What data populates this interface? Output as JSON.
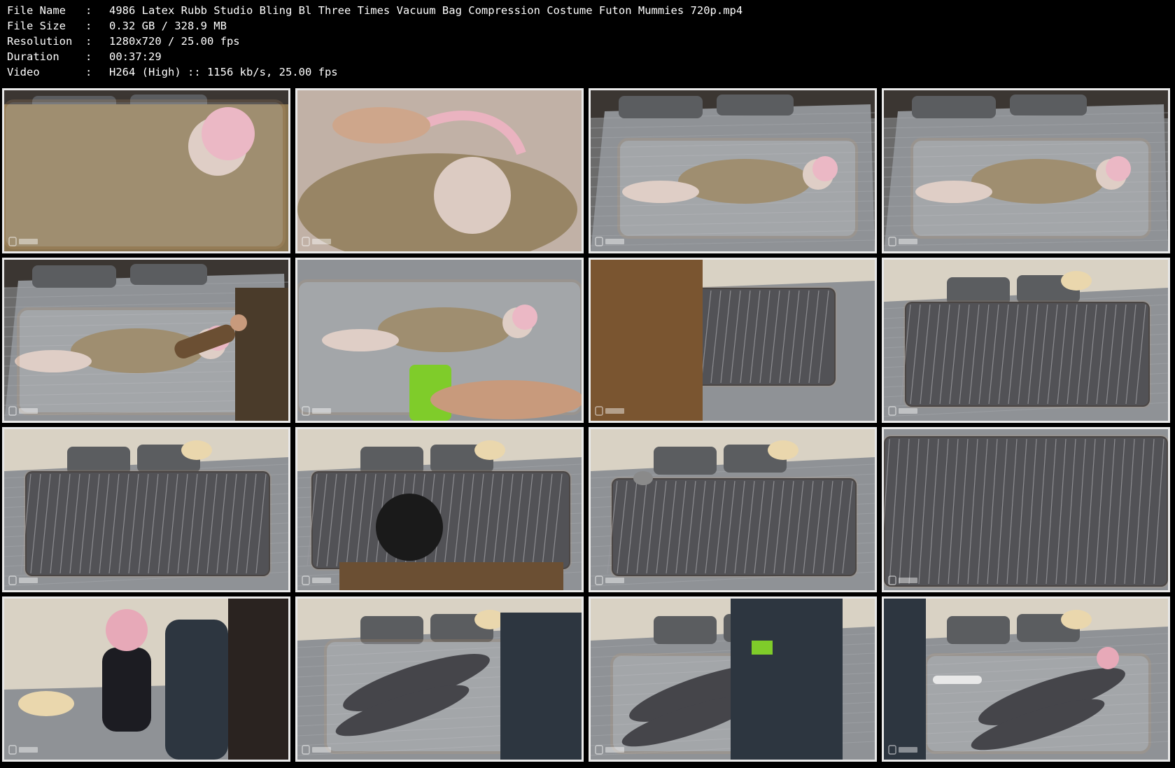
{
  "info": {
    "separator": ":",
    "rows": [
      {
        "label": "File Name",
        "value": "4986 Latex Rubb Studio Bling Bl Three Times Vacuum Bag Compression Costume Futon Mummies 720p.mp4"
      },
      {
        "label": "File Size",
        "value": "0.32 GB  / 328.9 MB"
      },
      {
        "label": "Resolution",
        "value": "1280x720 / 25.00 fps"
      },
      {
        "label": "Duration",
        "value": "00:37:29"
      },
      {
        "label": "Video",
        "value": "H264 (High) :: 1156 kb/s, 25.00 fps"
      }
    ]
  },
  "colors": {
    "background": "#000000",
    "text": "#ffffff",
    "thumb_border": "#e9e9e9",
    "bed_sheet": "#8f9296",
    "jacket": "#8a7550",
    "futon": "#3a3a3e",
    "wall": "#d9d2c4",
    "skin": "#d8c4ba",
    "hair": "#e7a9b8",
    "latex": "#1c1c22",
    "green_tool": "#7fcc2a",
    "zipper": "#c9a074"
  },
  "thumbnails": [
    {
      "scene": "jacket-bag-closeup",
      "icon": "person-in-vacuum-bag-icon"
    },
    {
      "scene": "hands-closeup",
      "icon": "hand-icon"
    },
    {
      "scene": "jacket-bag-bed",
      "icon": "person-in-vacuum-bag-icon"
    },
    {
      "scene": "jacket-bag-bed",
      "icon": "person-in-vacuum-bag-icon"
    },
    {
      "scene": "jacket-bag-with-helper",
      "icon": "person-in-vacuum-bag-icon"
    },
    {
      "scene": "jacket-bag-with-drill",
      "icon": "drill-icon"
    },
    {
      "scene": "futon-bag-helper",
      "icon": "futon-icon"
    },
    {
      "scene": "futon-bag",
      "icon": "futon-icon"
    },
    {
      "scene": "futon-bag",
      "icon": "futon-icon"
    },
    {
      "scene": "futon-bag-helper-head",
      "icon": "futon-icon"
    },
    {
      "scene": "futon-bag-cat",
      "icon": "futon-icon"
    },
    {
      "scene": "futon-bag-closeup",
      "icon": "futon-icon"
    },
    {
      "scene": "latex-standing",
      "icon": "person-icon"
    },
    {
      "scene": "latex-bag-helper",
      "icon": "person-in-vacuum-bag-icon"
    },
    {
      "scene": "latex-bag-helper-drill",
      "icon": "drill-icon"
    },
    {
      "scene": "latex-bag-wand",
      "icon": "person-in-vacuum-bag-icon"
    }
  ]
}
